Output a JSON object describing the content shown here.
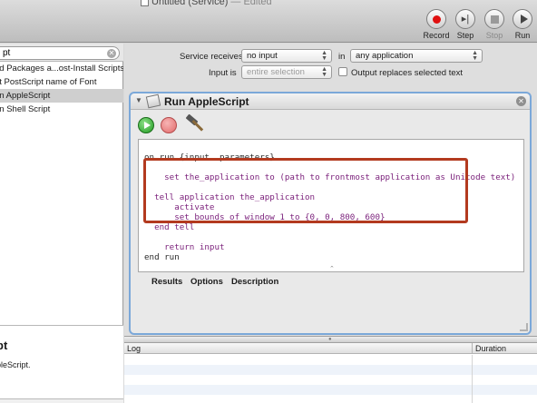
{
  "window": {
    "title": "Untitled (Service)",
    "edited": " — Edited"
  },
  "toolbar": {
    "record": "Record",
    "step": "Step",
    "stop": "Stop",
    "run": "Run"
  },
  "library": {
    "search_value": "pt",
    "items": [
      "dd Packages a...ost-Install Scripts",
      "et PostScript name of Font",
      "un AppleScript",
      "un Shell Script"
    ],
    "selected_index": 2
  },
  "description": {
    "title": "pt",
    "text": "pleScript."
  },
  "service": {
    "receives_label": "Service receives",
    "receives_value": "no input",
    "in_label": "in",
    "in_value": "any application",
    "input_is_label": "Input is",
    "input_is_value": "entire selection",
    "replace_label": "Output replaces selected text"
  },
  "action": {
    "title": "Run AppleScript",
    "code": [
      "on run {input, parameters}",
      "",
      "    set the_application to (path to frontmost application as Unicode text)",
      "",
      "  tell application the_application",
      "      activate",
      "      set bounds of window 1 to {0, 0, 800, 600}",
      "  end tell",
      "",
      "    return input",
      "end run"
    ],
    "tabs": [
      "Results",
      "Options",
      "Description"
    ]
  },
  "log": {
    "col_log": "Log",
    "col_duration": "Duration"
  }
}
